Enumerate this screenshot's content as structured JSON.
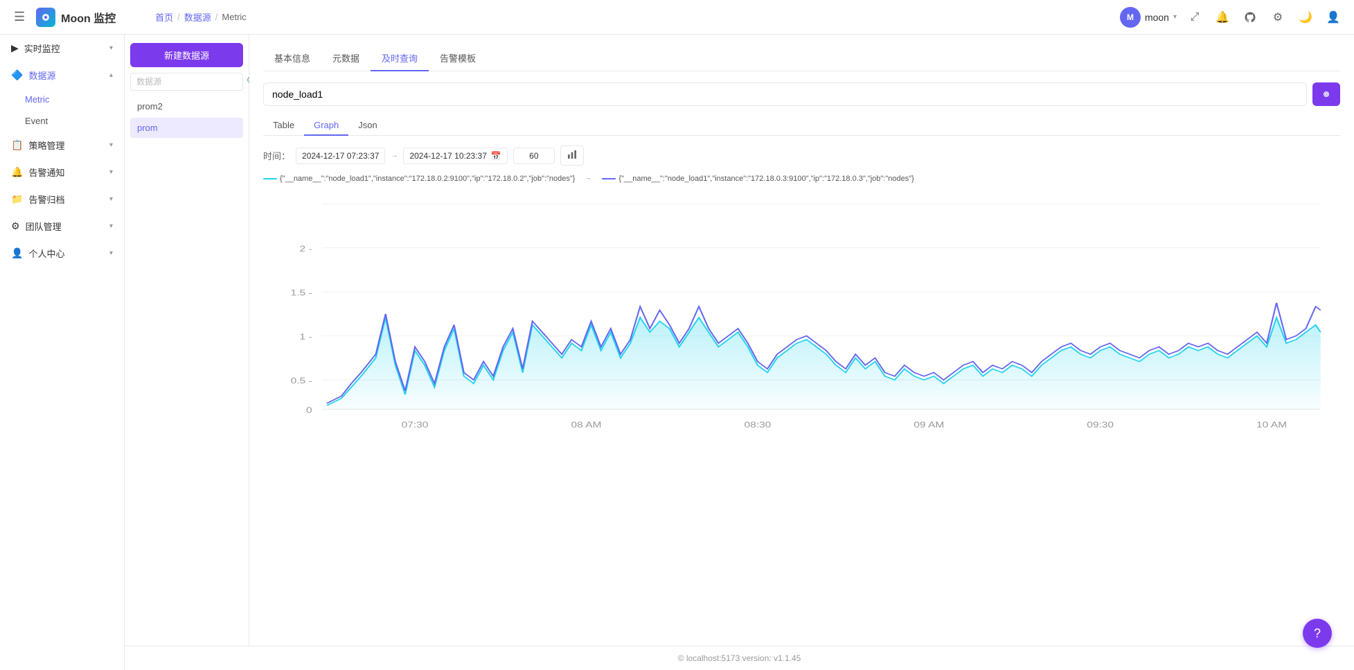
{
  "app": {
    "title": "Moon 监控",
    "logo_text": "Moon 监控"
  },
  "topbar": {
    "hamburger": "☰",
    "breadcrumb": {
      "home": "首页",
      "separator1": "/",
      "datasource": "数据源",
      "separator2": "/",
      "current": "Metric"
    },
    "user": {
      "name": "moon",
      "avatar_letter": "M"
    },
    "icons": {
      "expand": "⤢",
      "bell": "🔔",
      "github": "⬡",
      "settings": "⚙",
      "moon": "🌙",
      "user": "👤"
    }
  },
  "sidebar": {
    "items": [
      {
        "id": "realtime",
        "icon": "▶",
        "label": "实时监控",
        "expandable": true
      },
      {
        "id": "datasource",
        "icon": "🔷",
        "label": "数据源",
        "expandable": true,
        "active": true
      },
      {
        "id": "strategy",
        "icon": "📋",
        "label": "策略管理",
        "expandable": true
      },
      {
        "id": "alert_notify",
        "icon": "🔔",
        "label": "告警通知",
        "expandable": true
      },
      {
        "id": "alert_archive",
        "icon": "📁",
        "label": "告警归档",
        "expandable": true
      },
      {
        "id": "team",
        "icon": "⚙",
        "label": "团队管理",
        "expandable": true
      },
      {
        "id": "personal",
        "icon": "👤",
        "label": "个人中心",
        "expandable": true
      }
    ],
    "datasource_children": [
      {
        "id": "metric",
        "label": "Metric",
        "active": true
      },
      {
        "id": "event",
        "label": "Event"
      }
    ]
  },
  "source_panel": {
    "new_button": "新建数据源",
    "search_placeholder": "数据源",
    "items": [
      {
        "id": "prom2",
        "label": "prom2",
        "active": false
      },
      {
        "id": "prom",
        "label": "prom",
        "active": true
      }
    ]
  },
  "tabs": {
    "items": [
      {
        "id": "basic",
        "label": "基本信息",
        "active": false
      },
      {
        "id": "meta",
        "label": "元数据",
        "active": false
      },
      {
        "id": "query",
        "label": "及时查询",
        "active": true
      },
      {
        "id": "alert_tpl",
        "label": "告警模板",
        "active": false
      }
    ]
  },
  "query": {
    "input_value": "node_load1",
    "run_btn": "↺"
  },
  "view_tabs": {
    "items": [
      {
        "id": "table",
        "label": "Table",
        "active": false
      },
      {
        "id": "graph",
        "label": "Graph",
        "active": true
      },
      {
        "id": "json",
        "label": "Json",
        "active": false
      }
    ]
  },
  "time_range": {
    "label": "时间：",
    "start": "2024-12-17 07:23:37",
    "end": "2024-12-17 10:23:37",
    "step": "60"
  },
  "legend": {
    "items": [
      {
        "id": "series1",
        "label": "{\"__name__\":\"node_load1\",\"instance\":\"172.18.0.2:9100\",\"ip\":\"172.18.0.2\",\"job\":\"nodes\"}",
        "color": "#22d3ee"
      },
      {
        "id": "series2",
        "label": "{\"__name__\":\"node_load1\",\"instance\":\"172.18.0.3:9100\",\"ip\":\"172.18.0.3\",\"job\":\"nodes\"}",
        "color": "#6366f1"
      }
    ]
  },
  "chart": {
    "y_labels": [
      "0",
      "0.5 -",
      "1 -",
      "1.5 -",
      "2 -"
    ],
    "x_labels": [
      "07:30",
      "08 AM",
      "08:30",
      "09 AM",
      "09:30",
      "10 AM"
    ],
    "colors": {
      "line1": "#22d3ee",
      "line2": "#6366f1",
      "fill1": "rgba(34,211,238,0.15)"
    }
  },
  "footer": {
    "text": "© localhost:5173   version: v1.1.45"
  },
  "help_btn": "?"
}
